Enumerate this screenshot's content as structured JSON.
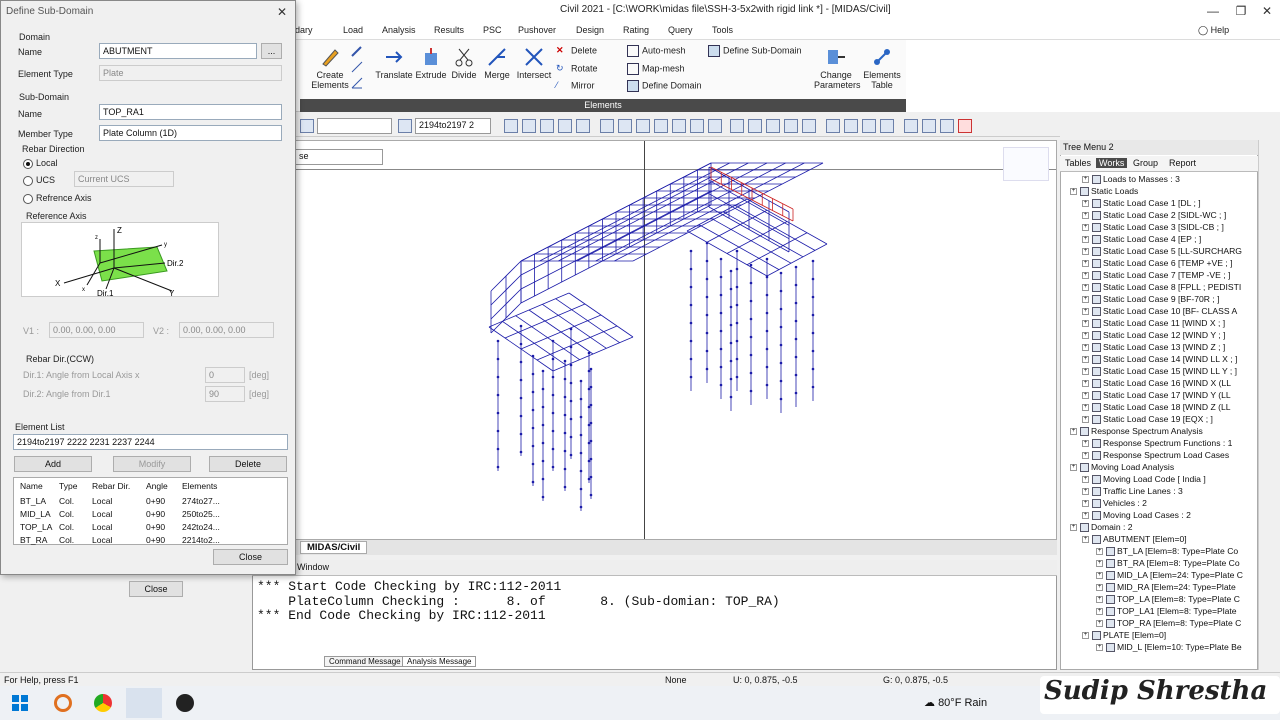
{
  "app": {
    "title": "Civil 2021 - [C:\\WORK\\midas file\\SSH-3-5x2with rigid link *] - [MIDAS/Civil]"
  },
  "menu": [
    "ndary",
    "Load",
    "Analysis",
    "Results",
    "PSC",
    "Pushover",
    "Design",
    "Rating",
    "Query",
    "Tools"
  ],
  "help": "Help",
  "ribbon": {
    "create": "Create Elements",
    "translate": "Translate",
    "extrude": "Extrude",
    "divide": "Divide",
    "merge": "Merge",
    "intersect": "Intersect",
    "delete": "Delete",
    "rotate": "Rotate",
    "mirror": "Mirror",
    "automesh": "Auto-mesh",
    "mapmesh": "Map-mesh",
    "define_domain": "Define Domain",
    "define_subdomain": "Define Sub-Domain",
    "change_params": "Change Parameters",
    "elem_table": "Elements Table",
    "group": "Elements"
  },
  "toolbar": {
    "select_value": "2194to2197 2"
  },
  "viewport": {
    "combo": "se",
    "tab": "MIDAS/Civil"
  },
  "dialog": {
    "title": "Define Sub-Domain",
    "domain_section": "Domain",
    "name_label": "Name",
    "name_value": "ABUTMENT",
    "browse": "...",
    "elem_type_label": "Element Type",
    "elem_type_value": "Plate",
    "sub_section": "Sub-Domain",
    "sub_name_label": "Name",
    "sub_name_value": "TOP_RA1",
    "member_type_label": "Member Type",
    "member_type_value": "Plate Column (1D)",
    "rebar_dir_label": "Rebar Direction",
    "local": "Local",
    "ucs": "UCS",
    "current_ucs": "Current UCS",
    "ref_axis_opt": "Refrence Axis",
    "ref_axis_label": "Reference Axis",
    "fig": {
      "z": "Z",
      "dir2": "Dir.2",
      "x": "X",
      "dir1": "Dir.1",
      "y": "Y",
      "sz": "z",
      "sy": "y",
      "sx": "x"
    },
    "v1_label": "V1 :",
    "v1_value": "0.00, 0.00, 0.00",
    "v2_label": "V2 :",
    "v2_value": "0.00, 0.00, 0.00",
    "rebar_ccw": "Rebar Dir.(CCW)",
    "dir1_label": "Dir.1: Angle from Local Axis x",
    "dir1_value": "0",
    "dir2_label": "Dir.2: Angle from Dir.1",
    "dir2_value": "90",
    "deg": "[deg]",
    "elem_list_label": "Element List",
    "elem_list_value": "2194to2197 2222 2231 2237 2244",
    "add": "Add",
    "modify": "Modify",
    "delete": "Delete",
    "table_headers": [
      "Name",
      "Type",
      "Rebar Dir.",
      "Angle",
      "Elements"
    ],
    "table_rows": [
      [
        "BT_LA",
        "Col.",
        "Local",
        "0+90",
        "274to27..."
      ],
      [
        "MID_LA",
        "Col.",
        "Local",
        "0+90",
        "250to25..."
      ],
      [
        "TOP_LA",
        "Col.",
        "Local",
        "0+90",
        "242to24..."
      ],
      [
        "BT_RA",
        "Col.",
        "Local",
        "0+90",
        "2214to2..."
      ]
    ],
    "close": "Close"
  },
  "behind_close": "Close",
  "message": {
    "title": "Window",
    "lines": [
      "*** Start Code Checking by IRC:112-2011",
      "    PlateColumn Checking :      8. of       8. (Sub-domian: TOP_RA)",
      "*** End Code Checking by IRC:112-2011"
    ],
    "tab1": "Command Message",
    "tab2": "Analysis Message"
  },
  "tree": {
    "title": "Tree Menu 2",
    "tabs": [
      "Tables",
      "Works",
      "Group",
      "Report"
    ],
    "rows": [
      "Loads to Masses : 3",
      "Static Loads",
      "Static Load Case 1 [DL ; ]",
      "Static Load Case 2 [SIDL-WC ; ]",
      "Static Load Case 3 [SIDL-CB ; ]",
      "Static Load Case 4 [EP ; ]",
      "Static Load Case 5 [LL-SURCHARG",
      "Static Load Case 6 [TEMP +VE ; ]",
      "Static Load Case 7 [TEMP -VE ; ]",
      "Static Load Case 8 [FPLL ; PEDISTI",
      "Static Load Case 9 [BF-70R ; ]",
      "Static Load Case 10 [BF- CLASS A",
      "Static Load Case 11 [WIND X ; ]",
      "Static Load Case 12 [WIND Y ; ]",
      "Static Load Case 13 [WIND Z ; ]",
      "Static Load Case 14 [WIND LL X ; ]",
      "Static Load Case 15 [WIND LL Y ; ]",
      "Static Load Case 16 [WIND X (LL",
      "Static Load Case 17 [WIND Y (LL",
      "Static Load Case 18 [WIND Z (LL",
      "Static Load Case 19 [EQX ; ]",
      "Response Spectrum Analysis",
      "Response Spectrum Functions : 1",
      "Response Spectrum Load Cases",
      "Moving Load Analysis",
      "Moving Load Code [ India ]",
      "Traffic Line Lanes : 3",
      "Vehicles : 2",
      "Moving Load Cases : 2",
      "Domain : 2",
      "ABUTMENT [Elem=0]",
      "BT_LA [Elem=8: Type=Plate Co",
      "BT_RA [Elem=8: Type=Plate Co",
      "MID_LA [Elem=24: Type=Plate C",
      "MID_RA [Elem=24: Type=Plate",
      "TOP_LA [Elem=8: Type=Plate C",
      "TOP_LA1 [Elem=8: Type=Plate",
      "TOP_RA [Elem=8: Type=Plate C",
      "PLATE [Elem=0]",
      "MID_L [Elem=10: Type=Plate Be"
    ]
  },
  "status": {
    "help": "For Help, press F1",
    "none": "None",
    "coord1": "U: 0, 0.875, -0.5",
    "coord2": "G: 0, 0.875, -0.5"
  },
  "taskbar": {
    "weather": "80°F  Rain"
  },
  "watermark": "Sudip Shrestha",
  "colors": {
    "mesh": "#1a1aa8",
    "highlight": "#cc2222",
    "accent": "#4a4a4a"
  }
}
